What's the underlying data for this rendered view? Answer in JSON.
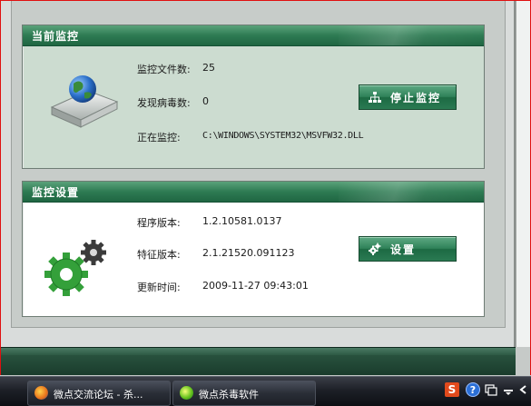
{
  "monitor": {
    "header": "当前监控",
    "files_label": "监控文件数:",
    "files_value": "25",
    "virus_label": "发现病毒数:",
    "virus_value": "0",
    "current_label": "正在监控:",
    "current_value": "C:\\WINDOWS\\SYSTEM32\\MSVFW32.DLL",
    "stop_button": "停止监控"
  },
  "settings": {
    "header": "监控设置",
    "program_label": "程序版本:",
    "program_value": "1.2.10581.0137",
    "signature_label": "特征版本:",
    "signature_value": "2.1.21520.091123",
    "update_label": "更新时间:",
    "update_value": "2009-11-27 09:43:01",
    "settings_button": "设置"
  },
  "taskbar": {
    "tasks": [
      {
        "label": "微点交流论坛 - 杀...",
        "icon": "firefox-icon"
      },
      {
        "label": "微点杀毒软件",
        "icon": "micropoint-icon"
      }
    ],
    "tray_icons": [
      "sogou-s-icon",
      "help-icon",
      "language-bar-icon",
      "options-icon",
      "collapse-icon"
    ]
  },
  "colors": {
    "header_green": "#2e7b53",
    "monitor_bg": "#ccdcd0",
    "button_green": "#2f8259"
  }
}
